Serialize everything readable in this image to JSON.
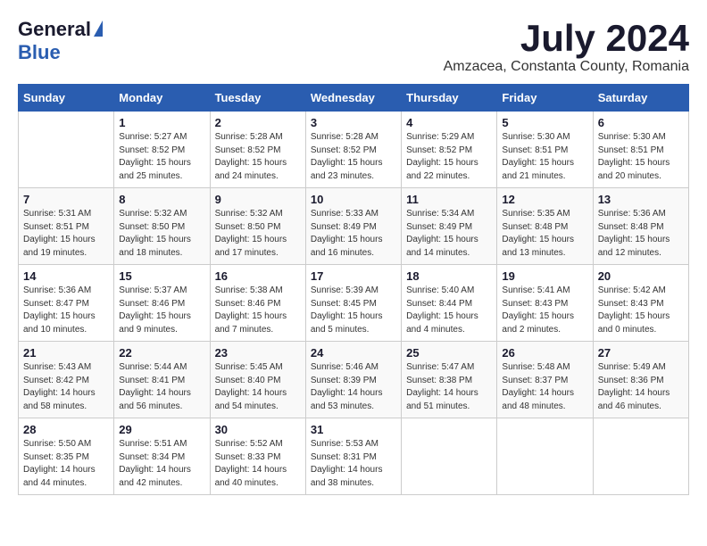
{
  "header": {
    "logo_general": "General",
    "logo_blue": "Blue",
    "month_year": "July 2024",
    "location": "Amzacea, Constanta County, Romania"
  },
  "days_of_week": [
    "Sunday",
    "Monday",
    "Tuesday",
    "Wednesday",
    "Thursday",
    "Friday",
    "Saturday"
  ],
  "weeks": [
    [
      {
        "day": "",
        "info": ""
      },
      {
        "day": "1",
        "info": "Sunrise: 5:27 AM\nSunset: 8:52 PM\nDaylight: 15 hours\nand 25 minutes."
      },
      {
        "day": "2",
        "info": "Sunrise: 5:28 AM\nSunset: 8:52 PM\nDaylight: 15 hours\nand 24 minutes."
      },
      {
        "day": "3",
        "info": "Sunrise: 5:28 AM\nSunset: 8:52 PM\nDaylight: 15 hours\nand 23 minutes."
      },
      {
        "day": "4",
        "info": "Sunrise: 5:29 AM\nSunset: 8:52 PM\nDaylight: 15 hours\nand 22 minutes."
      },
      {
        "day": "5",
        "info": "Sunrise: 5:30 AM\nSunset: 8:51 PM\nDaylight: 15 hours\nand 21 minutes."
      },
      {
        "day": "6",
        "info": "Sunrise: 5:30 AM\nSunset: 8:51 PM\nDaylight: 15 hours\nand 20 minutes."
      }
    ],
    [
      {
        "day": "7",
        "info": "Sunrise: 5:31 AM\nSunset: 8:51 PM\nDaylight: 15 hours\nand 19 minutes."
      },
      {
        "day": "8",
        "info": "Sunrise: 5:32 AM\nSunset: 8:50 PM\nDaylight: 15 hours\nand 18 minutes."
      },
      {
        "day": "9",
        "info": "Sunrise: 5:32 AM\nSunset: 8:50 PM\nDaylight: 15 hours\nand 17 minutes."
      },
      {
        "day": "10",
        "info": "Sunrise: 5:33 AM\nSunset: 8:49 PM\nDaylight: 15 hours\nand 16 minutes."
      },
      {
        "day": "11",
        "info": "Sunrise: 5:34 AM\nSunset: 8:49 PM\nDaylight: 15 hours\nand 14 minutes."
      },
      {
        "day": "12",
        "info": "Sunrise: 5:35 AM\nSunset: 8:48 PM\nDaylight: 15 hours\nand 13 minutes."
      },
      {
        "day": "13",
        "info": "Sunrise: 5:36 AM\nSunset: 8:48 PM\nDaylight: 15 hours\nand 12 minutes."
      }
    ],
    [
      {
        "day": "14",
        "info": "Sunrise: 5:36 AM\nSunset: 8:47 PM\nDaylight: 15 hours\nand 10 minutes."
      },
      {
        "day": "15",
        "info": "Sunrise: 5:37 AM\nSunset: 8:46 PM\nDaylight: 15 hours\nand 9 minutes."
      },
      {
        "day": "16",
        "info": "Sunrise: 5:38 AM\nSunset: 8:46 PM\nDaylight: 15 hours\nand 7 minutes."
      },
      {
        "day": "17",
        "info": "Sunrise: 5:39 AM\nSunset: 8:45 PM\nDaylight: 15 hours\nand 5 minutes."
      },
      {
        "day": "18",
        "info": "Sunrise: 5:40 AM\nSunset: 8:44 PM\nDaylight: 15 hours\nand 4 minutes."
      },
      {
        "day": "19",
        "info": "Sunrise: 5:41 AM\nSunset: 8:43 PM\nDaylight: 15 hours\nand 2 minutes."
      },
      {
        "day": "20",
        "info": "Sunrise: 5:42 AM\nSunset: 8:43 PM\nDaylight: 15 hours\nand 0 minutes."
      }
    ],
    [
      {
        "day": "21",
        "info": "Sunrise: 5:43 AM\nSunset: 8:42 PM\nDaylight: 14 hours\nand 58 minutes."
      },
      {
        "day": "22",
        "info": "Sunrise: 5:44 AM\nSunset: 8:41 PM\nDaylight: 14 hours\nand 56 minutes."
      },
      {
        "day": "23",
        "info": "Sunrise: 5:45 AM\nSunset: 8:40 PM\nDaylight: 14 hours\nand 54 minutes."
      },
      {
        "day": "24",
        "info": "Sunrise: 5:46 AM\nSunset: 8:39 PM\nDaylight: 14 hours\nand 53 minutes."
      },
      {
        "day": "25",
        "info": "Sunrise: 5:47 AM\nSunset: 8:38 PM\nDaylight: 14 hours\nand 51 minutes."
      },
      {
        "day": "26",
        "info": "Sunrise: 5:48 AM\nSunset: 8:37 PM\nDaylight: 14 hours\nand 48 minutes."
      },
      {
        "day": "27",
        "info": "Sunrise: 5:49 AM\nSunset: 8:36 PM\nDaylight: 14 hours\nand 46 minutes."
      }
    ],
    [
      {
        "day": "28",
        "info": "Sunrise: 5:50 AM\nSunset: 8:35 PM\nDaylight: 14 hours\nand 44 minutes."
      },
      {
        "day": "29",
        "info": "Sunrise: 5:51 AM\nSunset: 8:34 PM\nDaylight: 14 hours\nand 42 minutes."
      },
      {
        "day": "30",
        "info": "Sunrise: 5:52 AM\nSunset: 8:33 PM\nDaylight: 14 hours\nand 40 minutes."
      },
      {
        "day": "31",
        "info": "Sunrise: 5:53 AM\nSunset: 8:31 PM\nDaylight: 14 hours\nand 38 minutes."
      },
      {
        "day": "",
        "info": ""
      },
      {
        "day": "",
        "info": ""
      },
      {
        "day": "",
        "info": ""
      }
    ]
  ]
}
